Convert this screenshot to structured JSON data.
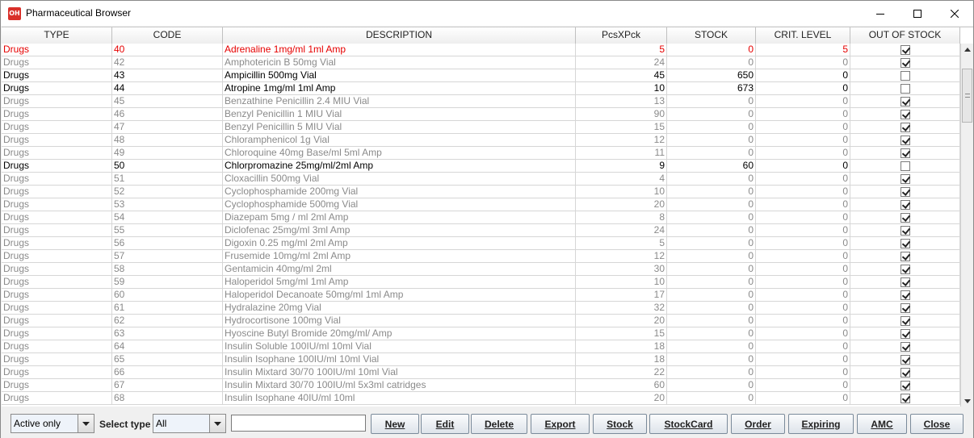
{
  "window": {
    "title": "Pharmaceutical Browser",
    "app_icon_text": "OH"
  },
  "table": {
    "columns": [
      "TYPE",
      "CODE",
      "DESCRIPTION",
      "PcsXPck",
      "STOCK",
      "CRIT. LEVEL",
      "OUT OF STOCK"
    ],
    "rows": [
      {
        "type": "Drugs",
        "code": "40",
        "desc": "Adrenaline 1mg/ml 1ml Amp",
        "pcs": "5",
        "stock": "0",
        "crit": "5",
        "out": true,
        "style": "red"
      },
      {
        "type": "Drugs",
        "code": "42",
        "desc": "Amphotericin B 50mg Vial",
        "pcs": "24",
        "stock": "0",
        "crit": "0",
        "out": true,
        "style": "grey"
      },
      {
        "type": "Drugs",
        "code": "43",
        "desc": "Ampicillin 500mg Vial",
        "pcs": "45",
        "stock": "650",
        "crit": "0",
        "out": false,
        "style": "black"
      },
      {
        "type": "Drugs",
        "code": "44",
        "desc": "Atropine 1mg/ml 1ml Amp",
        "pcs": "10",
        "stock": "673",
        "crit": "0",
        "out": false,
        "style": "black"
      },
      {
        "type": "Drugs",
        "code": "45",
        "desc": "Benzathine Penicillin 2.4 MIU Vial",
        "pcs": "13",
        "stock": "0",
        "crit": "0",
        "out": true,
        "style": "grey"
      },
      {
        "type": "Drugs",
        "code": "46",
        "desc": "Benzyl Penicillin 1 MIU Vial",
        "pcs": "90",
        "stock": "0",
        "crit": "0",
        "out": true,
        "style": "grey"
      },
      {
        "type": "Drugs",
        "code": "47",
        "desc": "Benzyl Penicillin 5 MIU Vial",
        "pcs": "15",
        "stock": "0",
        "crit": "0",
        "out": true,
        "style": "grey"
      },
      {
        "type": "Drugs",
        "code": "48",
        "desc": "Chloramphenicol 1g Vial",
        "pcs": "12",
        "stock": "0",
        "crit": "0",
        "out": true,
        "style": "grey"
      },
      {
        "type": "Drugs",
        "code": "49",
        "desc": "Chloroquine 40mg Base/ml 5ml Amp",
        "pcs": "11",
        "stock": "0",
        "crit": "0",
        "out": true,
        "style": "grey"
      },
      {
        "type": "Drugs",
        "code": "50",
        "desc": "Chlorpromazine 25mg/ml/2ml Amp",
        "pcs": "9",
        "stock": "60",
        "crit": "0",
        "out": false,
        "style": "black"
      },
      {
        "type": "Drugs",
        "code": "51",
        "desc": "Cloxacillin 500mg Vial",
        "pcs": "4",
        "stock": "0",
        "crit": "0",
        "out": true,
        "style": "grey"
      },
      {
        "type": "Drugs",
        "code": "52",
        "desc": "Cyclophosphamide 200mg Vial",
        "pcs": "10",
        "stock": "0",
        "crit": "0",
        "out": true,
        "style": "grey"
      },
      {
        "type": "Drugs",
        "code": "53",
        "desc": "Cyclophosphamide 500mg Vial",
        "pcs": "20",
        "stock": "0",
        "crit": "0",
        "out": true,
        "style": "grey"
      },
      {
        "type": "Drugs",
        "code": "54",
        "desc": "Diazepam 5mg / ml 2ml Amp",
        "pcs": "8",
        "stock": "0",
        "crit": "0",
        "out": true,
        "style": "grey"
      },
      {
        "type": "Drugs",
        "code": "55",
        "desc": "Diclofenac 25mg/ml 3ml Amp",
        "pcs": "24",
        "stock": "0",
        "crit": "0",
        "out": true,
        "style": "grey"
      },
      {
        "type": "Drugs",
        "code": "56",
        "desc": "Digoxin 0.25 mg/ml 2ml Amp",
        "pcs": "5",
        "stock": "0",
        "crit": "0",
        "out": true,
        "style": "grey"
      },
      {
        "type": "Drugs",
        "code": "57",
        "desc": "Frusemide 10mg/ml 2ml Amp",
        "pcs": "12",
        "stock": "0",
        "crit": "0",
        "out": true,
        "style": "grey"
      },
      {
        "type": "Drugs",
        "code": "58",
        "desc": "Gentamicin 40mg/ml 2ml",
        "pcs": "30",
        "stock": "0",
        "crit": "0",
        "out": true,
        "style": "grey"
      },
      {
        "type": "Drugs",
        "code": "59",
        "desc": "Haloperidol 5mg/ml 1ml Amp",
        "pcs": "10",
        "stock": "0",
        "crit": "0",
        "out": true,
        "style": "grey"
      },
      {
        "type": "Drugs",
        "code": "60",
        "desc": "Haloperidol Decanoate 50mg/ml 1ml Amp",
        "pcs": "17",
        "stock": "0",
        "crit": "0",
        "out": true,
        "style": "grey"
      },
      {
        "type": "Drugs",
        "code": "61",
        "desc": "Hydralazine 20mg Vial",
        "pcs": "32",
        "stock": "0",
        "crit": "0",
        "out": true,
        "style": "grey"
      },
      {
        "type": "Drugs",
        "code": "62",
        "desc": "Hydrocortisone 100mg Vial",
        "pcs": "20",
        "stock": "0",
        "crit": "0",
        "out": true,
        "style": "grey"
      },
      {
        "type": "Drugs",
        "code": "63",
        "desc": "Hyoscine Butyl Bromide 20mg/ml/ Amp",
        "pcs": "15",
        "stock": "0",
        "crit": "0",
        "out": true,
        "style": "grey"
      },
      {
        "type": "Drugs",
        "code": "64",
        "desc": "Insulin Soluble 100IU/ml 10ml Vial",
        "pcs": "18",
        "stock": "0",
        "crit": "0",
        "out": true,
        "style": "grey"
      },
      {
        "type": "Drugs",
        "code": "65",
        "desc": "Insulin Isophane 100IU/ml 10ml Vial",
        "pcs": "18",
        "stock": "0",
        "crit": "0",
        "out": true,
        "style": "grey"
      },
      {
        "type": "Drugs",
        "code": "66",
        "desc": "Insulin Mixtard 30/70 100IU/ml 10ml Vial",
        "pcs": "22",
        "stock": "0",
        "crit": "0",
        "out": true,
        "style": "grey"
      },
      {
        "type": "Drugs",
        "code": "67",
        "desc": "Insulin Mixtard 30/70 100IU/ml 5x3ml catridges",
        "pcs": "60",
        "stock": "0",
        "crit": "0",
        "out": true,
        "style": "grey"
      },
      {
        "type": "Drugs",
        "code": "68",
        "desc": "Insulin Isophane 40IU/ml 10ml",
        "pcs": "20",
        "stock": "0",
        "crit": "0",
        "out": true,
        "style": "grey"
      }
    ]
  },
  "colors": {
    "red_text": "#e60000",
    "grey_text": "#8a8a8a",
    "black_text": "#000000"
  },
  "toolbar": {
    "filter_combo": "Active only",
    "select_type_label": "Select type",
    "type_combo": "All",
    "search_value": "",
    "buttons": {
      "new": "New",
      "edit": "Edit",
      "delete": "Delete",
      "export": "Export",
      "stock": "Stock",
      "stockcard": "StockCard",
      "order": "Order",
      "expiring": "Expiring",
      "amc": "AMC",
      "close": "Close"
    }
  }
}
